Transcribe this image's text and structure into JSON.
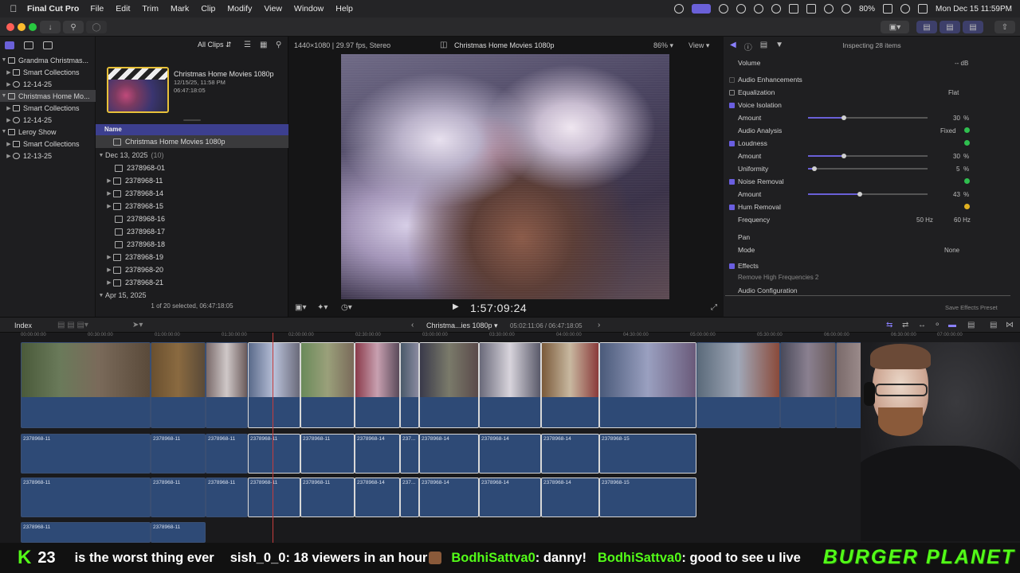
{
  "menubar": {
    "app_name": "Final Cut Pro",
    "items": [
      "File",
      "Edit",
      "Trim",
      "Mark",
      "Clip",
      "Modify",
      "View",
      "Window",
      "Help"
    ],
    "battery": "80%",
    "clock": "Mon Dec 15  11:59PM"
  },
  "library": {
    "rows": [
      {
        "label": "Grandma Christmas...",
        "level": 0,
        "selected": false
      },
      {
        "label": "Smart Collections",
        "level": 1,
        "selected": false
      },
      {
        "label": "12-14-25",
        "level": 1,
        "selected": false
      },
      {
        "label": "Christmas Home Mo...",
        "level": 0,
        "selected": true
      },
      {
        "label": "Smart Collections",
        "level": 1,
        "selected": false
      },
      {
        "label": "12-14-25",
        "level": 1,
        "selected": false
      },
      {
        "label": "Leroy Show",
        "level": 0,
        "selected": false
      },
      {
        "label": "Smart Collections",
        "level": 1,
        "selected": false
      },
      {
        "label": "12-13-25",
        "level": 1,
        "selected": false
      }
    ]
  },
  "browser": {
    "filter": "All Clips",
    "event_title": "Christmas Home Movies 1080p",
    "event_date": "12/15/25, 11:58 PM",
    "event_duration": "06:47:18:05",
    "column_header": "Name",
    "project_row": "Christmas Home Movies 1080p",
    "groups": [
      {
        "date": "Dec 13, 2025",
        "count": "(10)",
        "clips": [
          "2378968-01",
          "2378968-11",
          "2378968-14",
          "2378968-15",
          "2378968-16",
          "2378968-17",
          "2378968-18",
          "2378968-19",
          "2378968-20",
          "2378968-21"
        ]
      },
      {
        "date": "Apr 15, 2025",
        "count": "",
        "clips": []
      }
    ],
    "status": "1 of 20 selected, 06:47:18:05"
  },
  "viewer": {
    "format": "1440×1080 | 29.97 fps, Stereo",
    "title": "Christmas Home Movies 1080p",
    "zoom": "86%",
    "view_menu": "View",
    "timecode": "1:57:09:24"
  },
  "inspector": {
    "header": "Inspecting 28 items",
    "rows": {
      "volume": {
        "label": "Volume",
        "value": "-- dB"
      },
      "audio_enhancements": "Audio Enhancements",
      "equalization": {
        "label": "Equalization",
        "value": "Flat"
      },
      "voice_isolation": {
        "label": "Voice Isolation"
      },
      "vi_amount": {
        "label": "Amount",
        "value": "30",
        "unit": "%",
        "level": 0.3
      },
      "audio_analysis": {
        "label": "Audio Analysis",
        "value": "Fixed"
      },
      "loudness": {
        "label": "Loudness"
      },
      "loud_amount": {
        "label": "Amount",
        "value": "30",
        "unit": "%",
        "level": 0.3
      },
      "uniformity": {
        "label": "Uniformity",
        "value": "5",
        "unit": "%",
        "level": 0.05
      },
      "noise_removal": {
        "label": "Noise Removal"
      },
      "nr_amount": {
        "label": "Amount",
        "value": "43",
        "unit": "%",
        "level": 0.43
      },
      "hum_removal": {
        "label": "Hum Removal"
      },
      "frequency": {
        "label": "Frequency",
        "opt1": "50 Hz",
        "opt2": "60 Hz"
      },
      "pan": {
        "label": "Pan"
      },
      "mode": {
        "label": "Mode",
        "value": "None"
      },
      "effects": {
        "label": "Effects"
      },
      "effect_item": "Remove High Frequencies 2"
    },
    "audio_configuration": "Audio Configuration",
    "save_preset": "Save Effects Preset"
  },
  "timeline": {
    "index_label": "Index",
    "project": "Christma...ies 1080p",
    "position": "05:02:11:06 / 06:47:18:05",
    "ruler": [
      "00:00:00:00",
      "00:30:00:00",
      "01:00:00:00",
      "01:30:00:00",
      "02:00:00:00",
      "02:30:00:00",
      "03:00:00:00",
      "03:30:00:00",
      "04:00:00:00",
      "04:30:00:00",
      "05:00:00:00",
      "05:30:00:00",
      "06:00:00:00",
      "06:30:00:00",
      "07:00:00:00"
    ],
    "audio_row1": [
      "2378968-11",
      "2378968-11",
      "2378968-11",
      "2378968-11",
      "2378968-11",
      "2378968-14",
      "237...",
      "2378968-14",
      "2378968-14",
      "2378968-14",
      "2378968-15"
    ],
    "audio_row2": [
      "2378968-11",
      "2378968-11",
      "2378968-11",
      "2378968-11",
      "2378968-11",
      "2378968-14",
      "237...",
      "2378968-14",
      "2378968-14",
      "2378968-14",
      "2378968-15"
    ],
    "audio_row3": [
      "2378968-11",
      "2378968-11"
    ]
  },
  "stream": {
    "viewer_count": "23",
    "chat": [
      {
        "user": "",
        "text": "is the worst thing ever"
      },
      {
        "user": "sish_0_0",
        "text": ": 18 viewers in an hour"
      },
      {
        "user": "BodhiSattva0",
        "text": ": danny!"
      },
      {
        "user": "BodhiSattva0",
        "text": ": good to see u live"
      }
    ],
    "brand": "BURGER PLANET"
  }
}
